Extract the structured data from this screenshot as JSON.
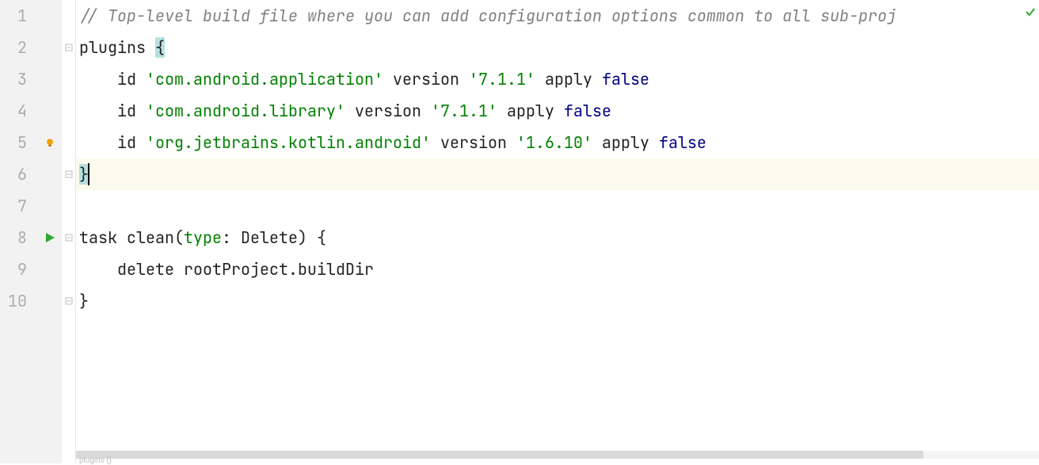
{
  "lines": {
    "l1": "1",
    "l2": "2",
    "l3": "3",
    "l4": "4",
    "l5": "5",
    "l6": "6",
    "l7": "7",
    "l8": "8",
    "l9": "9",
    "l10": "10"
  },
  "code": {
    "comment1": "// Top-level build file where you can add configuration options common to all sub-proj",
    "plugins_kw": "plugins ",
    "open_brace": "{",
    "indent2": "    ",
    "id_kw": "id ",
    "str_app": "'com.android.application'",
    "str_lib": "'com.android.library'",
    "str_kot": "'org.jetbrains.kotlin.android'",
    "sp": " ",
    "version_kw": "version ",
    "ver_711": "'7.1.1'",
    "ver_1610": "'1.6.10'",
    "apply_kw": "apply ",
    "false_kw": "false",
    "close_brace": "}",
    "task_kw": "task",
    "clean_name": " clean(",
    "type_kw": "type",
    "type_rest": ": Delete) {",
    "delete_line": "    delete rootProject.buildDir"
  },
  "breadcrumb": "plugins {}"
}
